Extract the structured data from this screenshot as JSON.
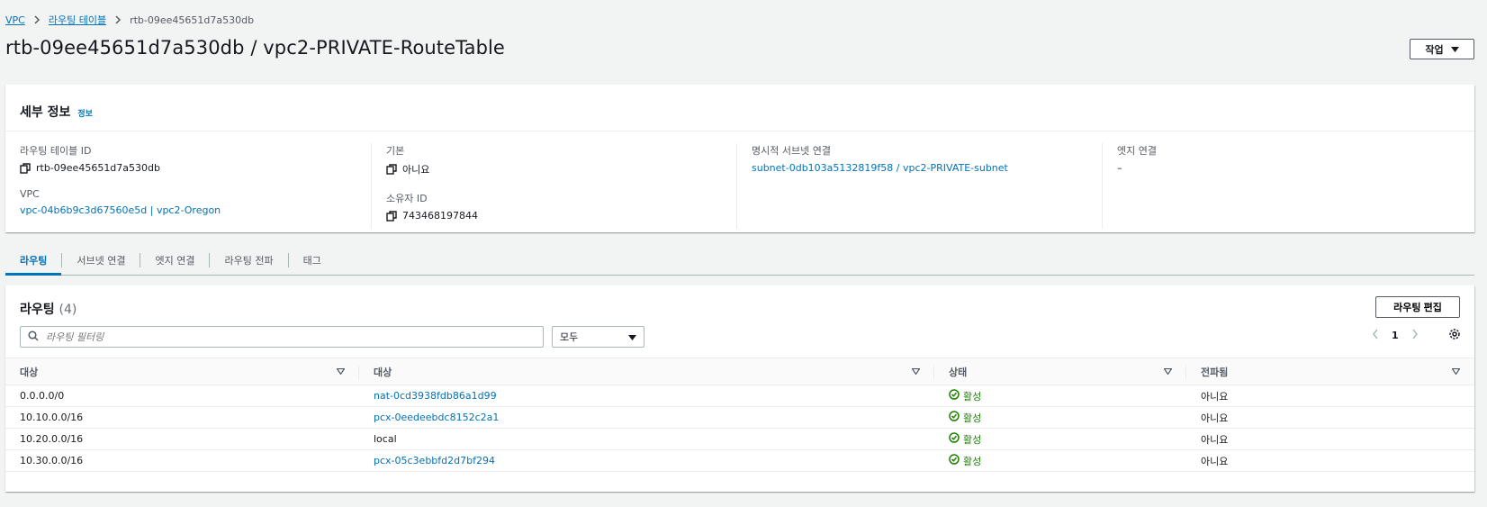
{
  "breadcrumb": {
    "items": [
      "VPC",
      "라우팅 테이블"
    ],
    "current": "rtb-09ee45651d7a530db"
  },
  "page": {
    "title": "rtb-09ee45651d7a530db / vpc2-PRIVATE-RouteTable",
    "actions_label": "작업"
  },
  "details": {
    "title": "세부 정보",
    "info_link": "정보",
    "route_table_id_label": "라우팅 테이블 ID",
    "route_table_id": "rtb-09ee45651d7a530db",
    "vpc_label": "VPC",
    "vpc_value": "vpc-04b6b9c3d67560e5d | vpc2-Oregon",
    "main_label": "기본",
    "main_value": "아니요",
    "owner_label": "소유자 ID",
    "owner_value": "743468197844",
    "explicit_subnet_label": "명시적 서브넷 연결",
    "explicit_subnet_value": "subnet-0db103a5132819f58 / vpc2-PRIVATE-subnet",
    "edge_label": "엣지 연결",
    "edge_value": "–"
  },
  "tabs": [
    "라우팅",
    "서브넷 연결",
    "엣지 연결",
    "라우팅 전파",
    "태그"
  ],
  "routes": {
    "title": "라우팅",
    "count": "(4)",
    "edit_label": "라우팅 편집",
    "search_placeholder": "라우팅 필터링",
    "filter_value": "모두",
    "page": "1",
    "columns": [
      "대상",
      "대상",
      "상태",
      "전파됨"
    ],
    "rows": [
      {
        "destination": "0.0.0.0/0",
        "target": "nat-0cd3938fdb86a1d99",
        "status": "활성",
        "propagated": "아니요"
      },
      {
        "destination": "10.10.0.0/16",
        "target": "pcx-0eedeebdc8152c2a1",
        "status": "활성",
        "propagated": "아니요"
      },
      {
        "destination": "10.20.0.0/16",
        "target": "local",
        "status": "활성",
        "propagated": "아니요"
      },
      {
        "destination": "10.30.0.0/16",
        "target": "pcx-05c3ebbfd2d7bf294",
        "status": "활성",
        "propagated": "아니요"
      }
    ]
  },
  "colors": {
    "link": "#0073bb",
    "success": "#1d8102",
    "text": "#16191f",
    "background": "#f2f3f3"
  }
}
